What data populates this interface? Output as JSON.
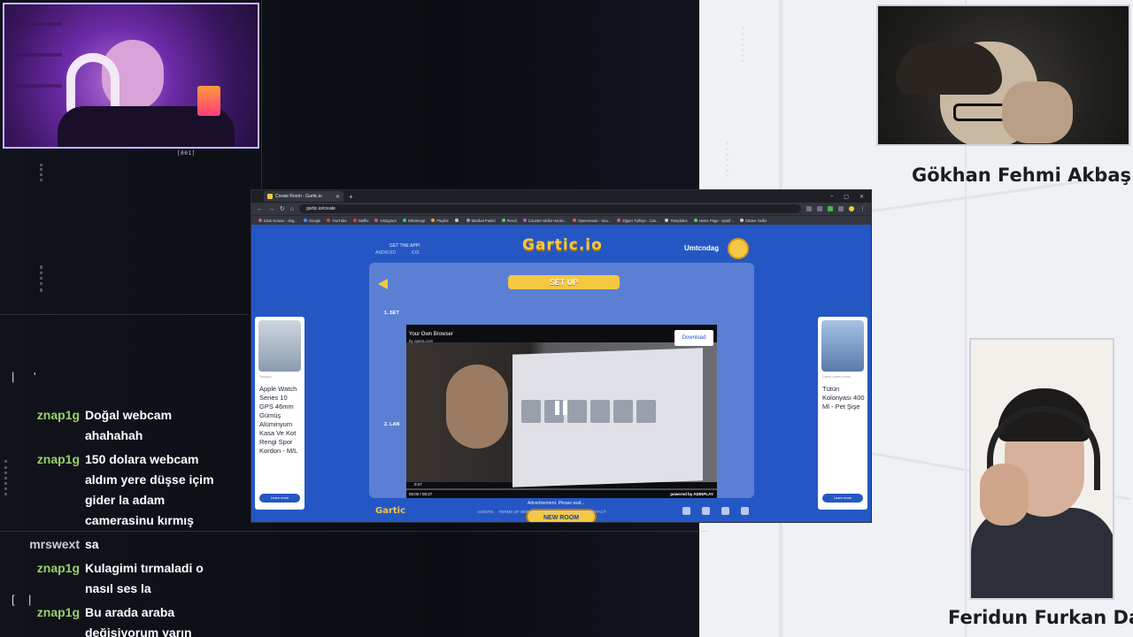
{
  "streamer_cam": {
    "overlay_label": "[001]"
  },
  "guests": [
    {
      "name": "Gökhan Fehmi Akbaş"
    },
    {
      "name": "Feridun Furkan Dağ"
    }
  ],
  "chat": {
    "markers": [
      "|",
      "'",
      "[",
      "|"
    ],
    "messages": [
      {
        "user": "znap1g",
        "user_color": "#9bd06a",
        "text": "Doğal webcam ahahahah"
      },
      {
        "user": "znap1g",
        "user_color": "#9bd06a",
        "text": "150 dolara webcam aldım yere düşse içim gider la adam camerasinu kırmış"
      },
      {
        "user": "mrswext",
        "user_color": "#c9cdd6",
        "text": "sa"
      },
      {
        "user": "znap1g",
        "user_color": "#9bd06a",
        "text": "Kulagimi tırmaladi o nasıl ses la"
      },
      {
        "user": "znap1g",
        "user_color": "#9bd06a",
        "text": "Bu arada araba değişiyorum yarın"
      }
    ]
  },
  "browser": {
    "tab_title": "Create Room - Gartic.io",
    "url": "gartic.io/create",
    "bookmarks": [
      {
        "label": "Ekim Kutusu - dog...",
        "color": "#e05a5a"
      },
      {
        "label": "Google",
        "color": "#4a8af4"
      },
      {
        "label": "YouTube",
        "color": "#e53935"
      },
      {
        "label": "Netflix",
        "color": "#e53935"
      },
      {
        "label": "Instagram",
        "color": "#d94a8c"
      },
      {
        "label": "WhatsApp",
        "color": "#25d366"
      },
      {
        "label": "Playlist",
        "color": "#f0a030"
      },
      {
        "label": "",
        "color": "#c5c9d2"
      },
      {
        "label": "Müzikal Pastel",
        "color": "#8a9ad6"
      },
      {
        "label": "Pencil",
        "color": "#6fbf73"
      },
      {
        "label": "Counter-Strike Hacks...",
        "color": "#a05ad6"
      },
      {
        "label": "OpenHouse - Sou...",
        "color": "#e05a5a"
      },
      {
        "label": "Zipper Turkiye - Cas...",
        "color": "#e05a5a"
      },
      {
        "label": "Templates",
        "color": "#c5c9d2"
      },
      {
        "label": "Home Page - spotif...",
        "color": "#6fbf73"
      },
      {
        "label": "Sticker Gellix",
        "color": "#c5c9d2"
      }
    ],
    "page": {
      "logo": "Gartic.io",
      "get_app": "GET THE APP!",
      "platforms": [
        "ANDROID",
        "iOS"
      ],
      "username": "Umtcndag",
      "setup_label": "SET UP",
      "section1": "1. SET",
      "section2": "2. LAN",
      "ad_wait": "Advertisement. Please wait...",
      "new_room": "NEW ROOM",
      "footer_logo": "Gartic",
      "footer_links": [
        "AGENTS",
        "TERMS OF SERVICE",
        "PRIVACY",
        "THANKS",
        "CONTACT"
      ],
      "side_ad_left": {
        "meta": "Trendyol",
        "title": "Apple Watch Series 10 GPS 46mm Gümüş Alüminyum Kasa Ve Kot Rengi Spor Kordon - M/L",
        "button": "Learn more"
      },
      "side_ad_right": {
        "meta": "Lorem Lorem Lorem",
        "title": "Tütün Kolonyası 400 Ml - Pet Şişe",
        "button": "Learn more"
      }
    },
    "video_ad": {
      "title": "Your Own Browser",
      "subtitle": "by opera.com",
      "download": "Download",
      "time_left": "0:27",
      "timeline": "00:00 / 00:27",
      "powered": "powered by ADINPLAY"
    }
  }
}
